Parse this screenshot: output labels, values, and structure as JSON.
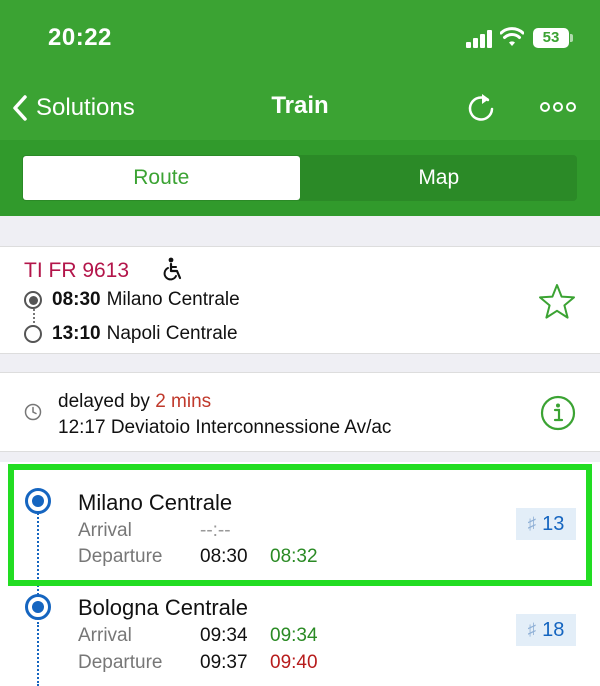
{
  "status": {
    "time": "20:22",
    "battery": "53"
  },
  "nav": {
    "back_label": "Solutions",
    "title": "Train"
  },
  "segment": {
    "route_label": "Route",
    "map_label": "Map"
  },
  "train": {
    "code": "TI FR 9613",
    "departure_time": "08:30",
    "departure_station": "Milano Centrale",
    "arrival_time": "13:10",
    "arrival_station": "Napoli Centrale"
  },
  "delay": {
    "prefix": "delayed by",
    "amount": "2 mins",
    "location": "12:17 Deviatoio Interconnessione Av/ac"
  },
  "stops": [
    {
      "name": "Milano Centrale",
      "arrival_label": "Arrival",
      "arrival_scheduled": "--:--",
      "arrival_actual": "",
      "departure_label": "Departure",
      "departure_scheduled": "08:30",
      "departure_actual": "08:32",
      "platform": "13"
    },
    {
      "name": "Bologna Centrale",
      "arrival_label": "Arrival",
      "arrival_scheduled": "09:34",
      "arrival_actual": "09:34",
      "departure_label": "Departure",
      "departure_scheduled": "09:37",
      "departure_actual": "09:40",
      "platform": "18"
    }
  ],
  "colors": {
    "header_green": "#3ba333",
    "train_code": "#b3154a",
    "stop_blue": "#1565c0",
    "on_time_green": "#2a8a24",
    "late_red": "#b71c1c",
    "highlight": "#22dd22"
  }
}
